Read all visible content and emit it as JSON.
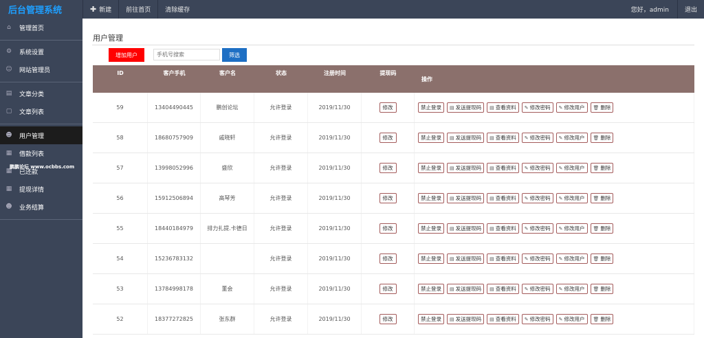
{
  "app": {
    "title": "后台管理系统"
  },
  "topnav": {
    "new_label": "新建",
    "home_label": "前往首页",
    "clear_cache_label": "清除缓存",
    "greeting": "您好，admin",
    "logout_label": "退出"
  },
  "sidebar": {
    "items": [
      {
        "label": "管理首页",
        "icon": "home-icon"
      },
      {
        "label": "系统设置",
        "icon": "gear-icon"
      },
      {
        "label": "网站管理员",
        "icon": "user-icon"
      },
      {
        "label": "文章分类",
        "icon": "book-icon"
      },
      {
        "label": "文章列表",
        "icon": "document-icon"
      },
      {
        "label": "用户管理",
        "icon": "users-icon"
      },
      {
        "label": "借款列表",
        "icon": "grid-icon"
      },
      {
        "label": "已还款",
        "icon": "grid-icon"
      },
      {
        "label": "提现详情",
        "icon": "grid-icon"
      },
      {
        "label": "业务结算",
        "icon": "users-icon"
      }
    ],
    "watermark": "鹏鹏论坛 www.ocbbs.com"
  },
  "main": {
    "page_title": "用户管理",
    "add_user_label": "增加用户",
    "search_placeholder": "手机号搜索",
    "filter_label": "筛选"
  },
  "table": {
    "headers": {
      "id": "ID",
      "phone": "客户手机",
      "name": "客户名",
      "status": "状态",
      "reg_time": "注册时间",
      "withdraw_code": "提现码",
      "ops": "操作"
    },
    "edit_label": "修改",
    "actions": {
      "ban": "禁止登录",
      "send_code": "发送提现码",
      "view": "查看资料",
      "change_pwd": "修改密码",
      "edit_user": "修改用户",
      "delete": "删除"
    },
    "rows": [
      {
        "id": "59",
        "phone": "13404490445",
        "name": "鹏创论坛",
        "status": "允许登录",
        "reg_time": "2019/11/30"
      },
      {
        "id": "58",
        "phone": "18680757909",
        "name": "戚晓轩",
        "status": "允许登录",
        "reg_time": "2019/11/30"
      },
      {
        "id": "57",
        "phone": "13998052996",
        "name": "盛欣",
        "status": "允许登录",
        "reg_time": "2019/11/30"
      },
      {
        "id": "56",
        "phone": "15912506894",
        "name": "高琴芳",
        "status": "允许登录",
        "reg_time": "2019/11/30"
      },
      {
        "id": "55",
        "phone": "18440184979",
        "name": "排力扎提.卡德日",
        "status": "允许登录",
        "reg_time": "2019/11/30"
      },
      {
        "id": "54",
        "phone": "15236783132",
        "name": "",
        "status": "允许登录",
        "reg_time": "2019/11/30"
      },
      {
        "id": "53",
        "phone": "13784998178",
        "name": "董会",
        "status": "允许登录",
        "reg_time": "2019/11/30"
      },
      {
        "id": "52",
        "phone": "18377272825",
        "name": "张东群",
        "status": "允许登录",
        "reg_time": "2019/11/30"
      }
    ]
  },
  "colors": {
    "topbar": "#3b4558",
    "brand": "#1e9fff",
    "table_header": "#8b706c",
    "add_button": "#ff0000",
    "filter_button": "#1e6fc4",
    "action_border": "#a35a5a"
  }
}
